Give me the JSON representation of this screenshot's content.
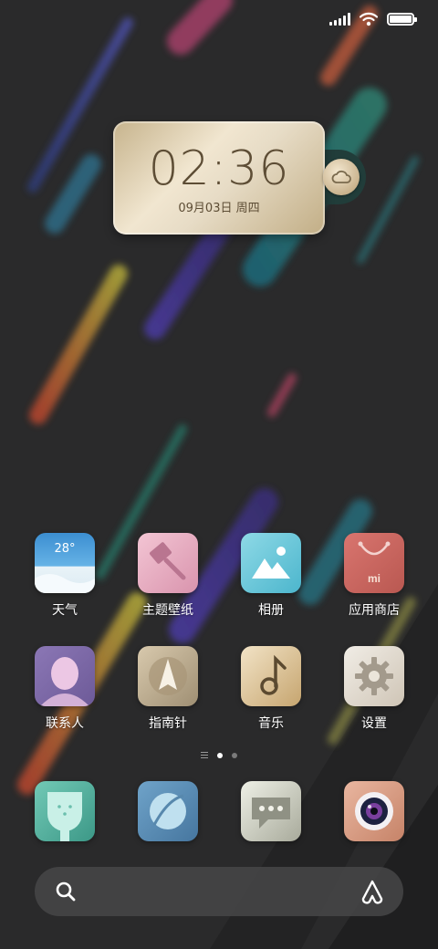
{
  "status_bar": {
    "signal_icon": "signal-icon",
    "wifi_icon": "wifi-icon",
    "battery_icon": "battery-icon",
    "battery_level": 1.0
  },
  "clock_widget": {
    "time": "02:36",
    "date": "09月03日 周四",
    "weather_icon": "cloud-icon"
  },
  "apps": [
    {
      "label": "天气",
      "icon": "weather-icon",
      "badge_text": "28°"
    },
    {
      "label": "主题壁纸",
      "icon": "theme-brush-icon"
    },
    {
      "label": "相册",
      "icon": "gallery-icon"
    },
    {
      "label": "应用商店",
      "icon": "app-store-bag-icon",
      "badge_text": "mi"
    },
    {
      "label": "联系人",
      "icon": "contacts-icon"
    },
    {
      "label": "指南针",
      "icon": "compass-icon"
    },
    {
      "label": "音乐",
      "icon": "music-note-icon"
    },
    {
      "label": "设置",
      "icon": "settings-gear-icon"
    }
  ],
  "page_indicator": {
    "pages": 2,
    "active_index": 0
  },
  "dock": [
    {
      "icon": "phone-icon"
    },
    {
      "icon": "browser-icon"
    },
    {
      "icon": "messages-icon"
    },
    {
      "icon": "camera-icon"
    }
  ],
  "search_bar": {
    "search_icon": "search-icon",
    "assistant_icon": "assistant-icon"
  },
  "colors": {
    "background": "#2a2a2b",
    "widget_text": "#5d4d35"
  }
}
